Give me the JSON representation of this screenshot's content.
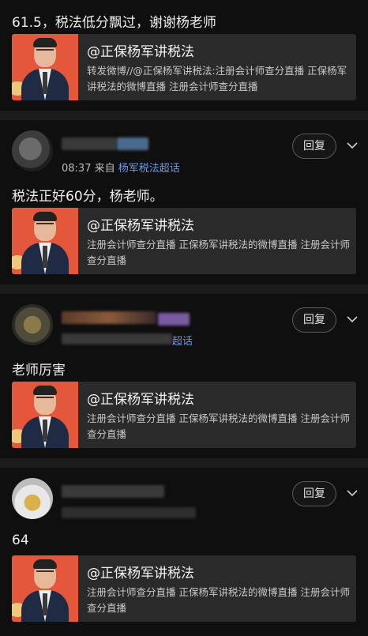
{
  "card": {
    "title": "@正保杨军讲税法",
    "desc_full": "注册会计师查分直播  正保杨军讲税法的微博直播 注册会计师查分直播",
    "desc_forward": "转发微博//@正保杨军讲税法:注册会计师查分直播  正保杨军讲税法的微博直播 注册会计师查分直播"
  },
  "post0": {
    "text": "61.5，税法低分飘过，谢谢杨老师"
  },
  "post1": {
    "time": "08:37",
    "from_label": "来自",
    "source": "杨军税法超话",
    "reply_label": "回复",
    "text": "税法正好60分，杨老师。"
  },
  "post2": {
    "source": "超话",
    "reply_label": "回复",
    "text": "老师厉害"
  },
  "post3": {
    "reply_label": "回复",
    "text": "64"
  },
  "icons": {
    "reply_chevron": "chevron-down-icon",
    "avatar": "avatar-icon"
  },
  "colors": {
    "background": "#0b0b0b",
    "card": "#2a2a2a",
    "link": "#6b9be0",
    "separator": "#1c1c1c"
  }
}
